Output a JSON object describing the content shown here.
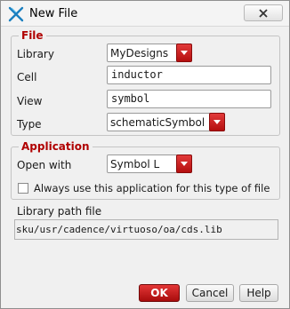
{
  "window": {
    "title": "New File",
    "close_icon": "close-icon"
  },
  "file_group": {
    "title": "File",
    "library_label": "Library",
    "library_value": "MyDesigns",
    "cell_label": "Cell",
    "cell_value": "inductor",
    "view_label": "View",
    "view_value": "symbol",
    "type_label": "Type",
    "type_value": "schematicSymbol"
  },
  "application_group": {
    "title": "Application",
    "open_with_label": "Open with",
    "open_with_value": "Symbol L",
    "always_use_label": "Always use this application for this type of file",
    "always_use_checked": false
  },
  "library_path": {
    "label": "Library path file",
    "value": "sku/usr/cadence/virtuoso/oa/cds.lib"
  },
  "buttons": {
    "ok": "OK",
    "cancel": "Cancel",
    "help": "Help"
  },
  "colors": {
    "accent_red": "#b40f0f",
    "group_title": "#b00000"
  }
}
